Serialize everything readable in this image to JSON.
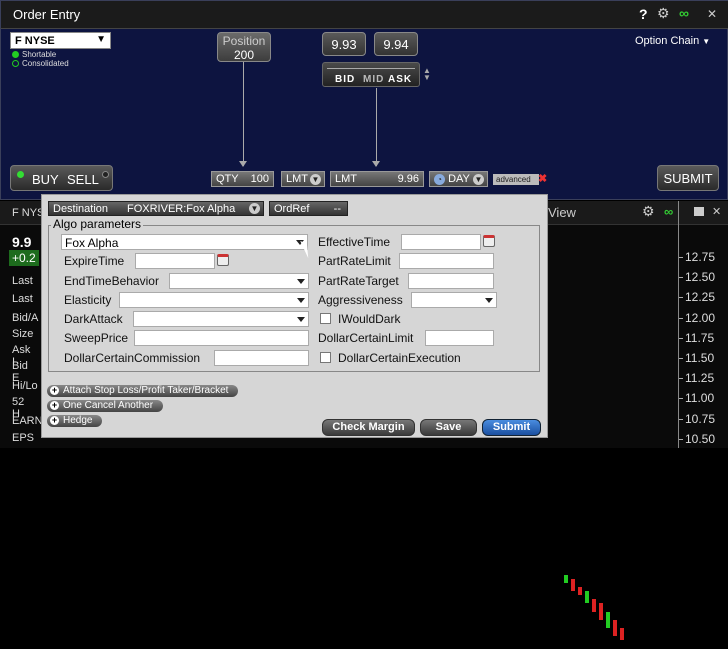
{
  "window": {
    "title": "Order Entry"
  },
  "exchange": {
    "symbol": "F",
    "venue": "NYSE",
    "shortable": "Shortable",
    "consolidated": "Consolidated"
  },
  "position": {
    "label": "Position",
    "value": "200"
  },
  "quote": {
    "bid": "9.93",
    "ask": "9.94",
    "bid_label": "BID",
    "mid_label": "MID",
    "ask_label": "ASK"
  },
  "option_chain": "Option Chain",
  "order": {
    "buy": "BUY",
    "sell": "SELL",
    "qty_label": "QTY",
    "qty": "100",
    "type": "LMT",
    "lmt_label": "LMT",
    "lmt_price": "9.96",
    "tif": "DAY",
    "advanced": "advanced",
    "submit": "SUBMIT"
  },
  "background": {
    "symbol_frag": "F NYS",
    "price_frag": "9.9",
    "change_frag": "+0.2",
    "rows": [
      "Last",
      "Last",
      "Bid/A",
      "Size",
      "Ask I",
      "Bid E",
      "Hi/Lo",
      "52 H",
      "EARN",
      "EPS"
    ],
    "view_label": "View",
    "yticks": [
      "12.75",
      "12.50",
      "12.25",
      "12.00",
      "11.75",
      "11.50",
      "11.25",
      "11.00",
      "10.75",
      "10.50"
    ]
  },
  "chart_data": {
    "type": "candlestick",
    "yticks": [
      "12.75",
      "12.50",
      "12.25",
      "12.00",
      "11.75",
      "11.50",
      "11.25",
      "11.00",
      "10.75",
      "10.50"
    ],
    "ylim": [
      10.45,
      12.85
    ]
  },
  "algo": {
    "destination_label": "Destination",
    "destination_value": "FOXRIVER:Fox Alpha",
    "ordref_label": "OrdRef",
    "ordref_value": "--",
    "group_title": "Algo parameters",
    "strategy": "Fox Alpha",
    "labels": {
      "effective_time": "EffectiveTime",
      "expire_time": "ExpireTime",
      "part_rate_limit": "PartRateLimit",
      "end_time_behavior": "EndTimeBehavior",
      "part_rate_target": "PartRateTarget",
      "elasticity": "Elasticity",
      "aggressiveness": "Aggressiveness",
      "dark_attack": "DarkAttack",
      "i_would_dark": "IWouldDark",
      "sweep_price": "SweepPrice",
      "dollar_certain_limit": "DollarCertainLimit",
      "dollar_certain_commission": "DollarCertainCommission",
      "dollar_certain_execution": "DollarCertainExecution"
    },
    "links": {
      "attach": "Attach Stop Loss/Profit Taker/Bracket",
      "oca": "One Cancel Another",
      "hedge": "Hedge"
    },
    "buttons": {
      "check_margin": "Check Margin",
      "save": "Save",
      "submit": "Submit"
    }
  }
}
